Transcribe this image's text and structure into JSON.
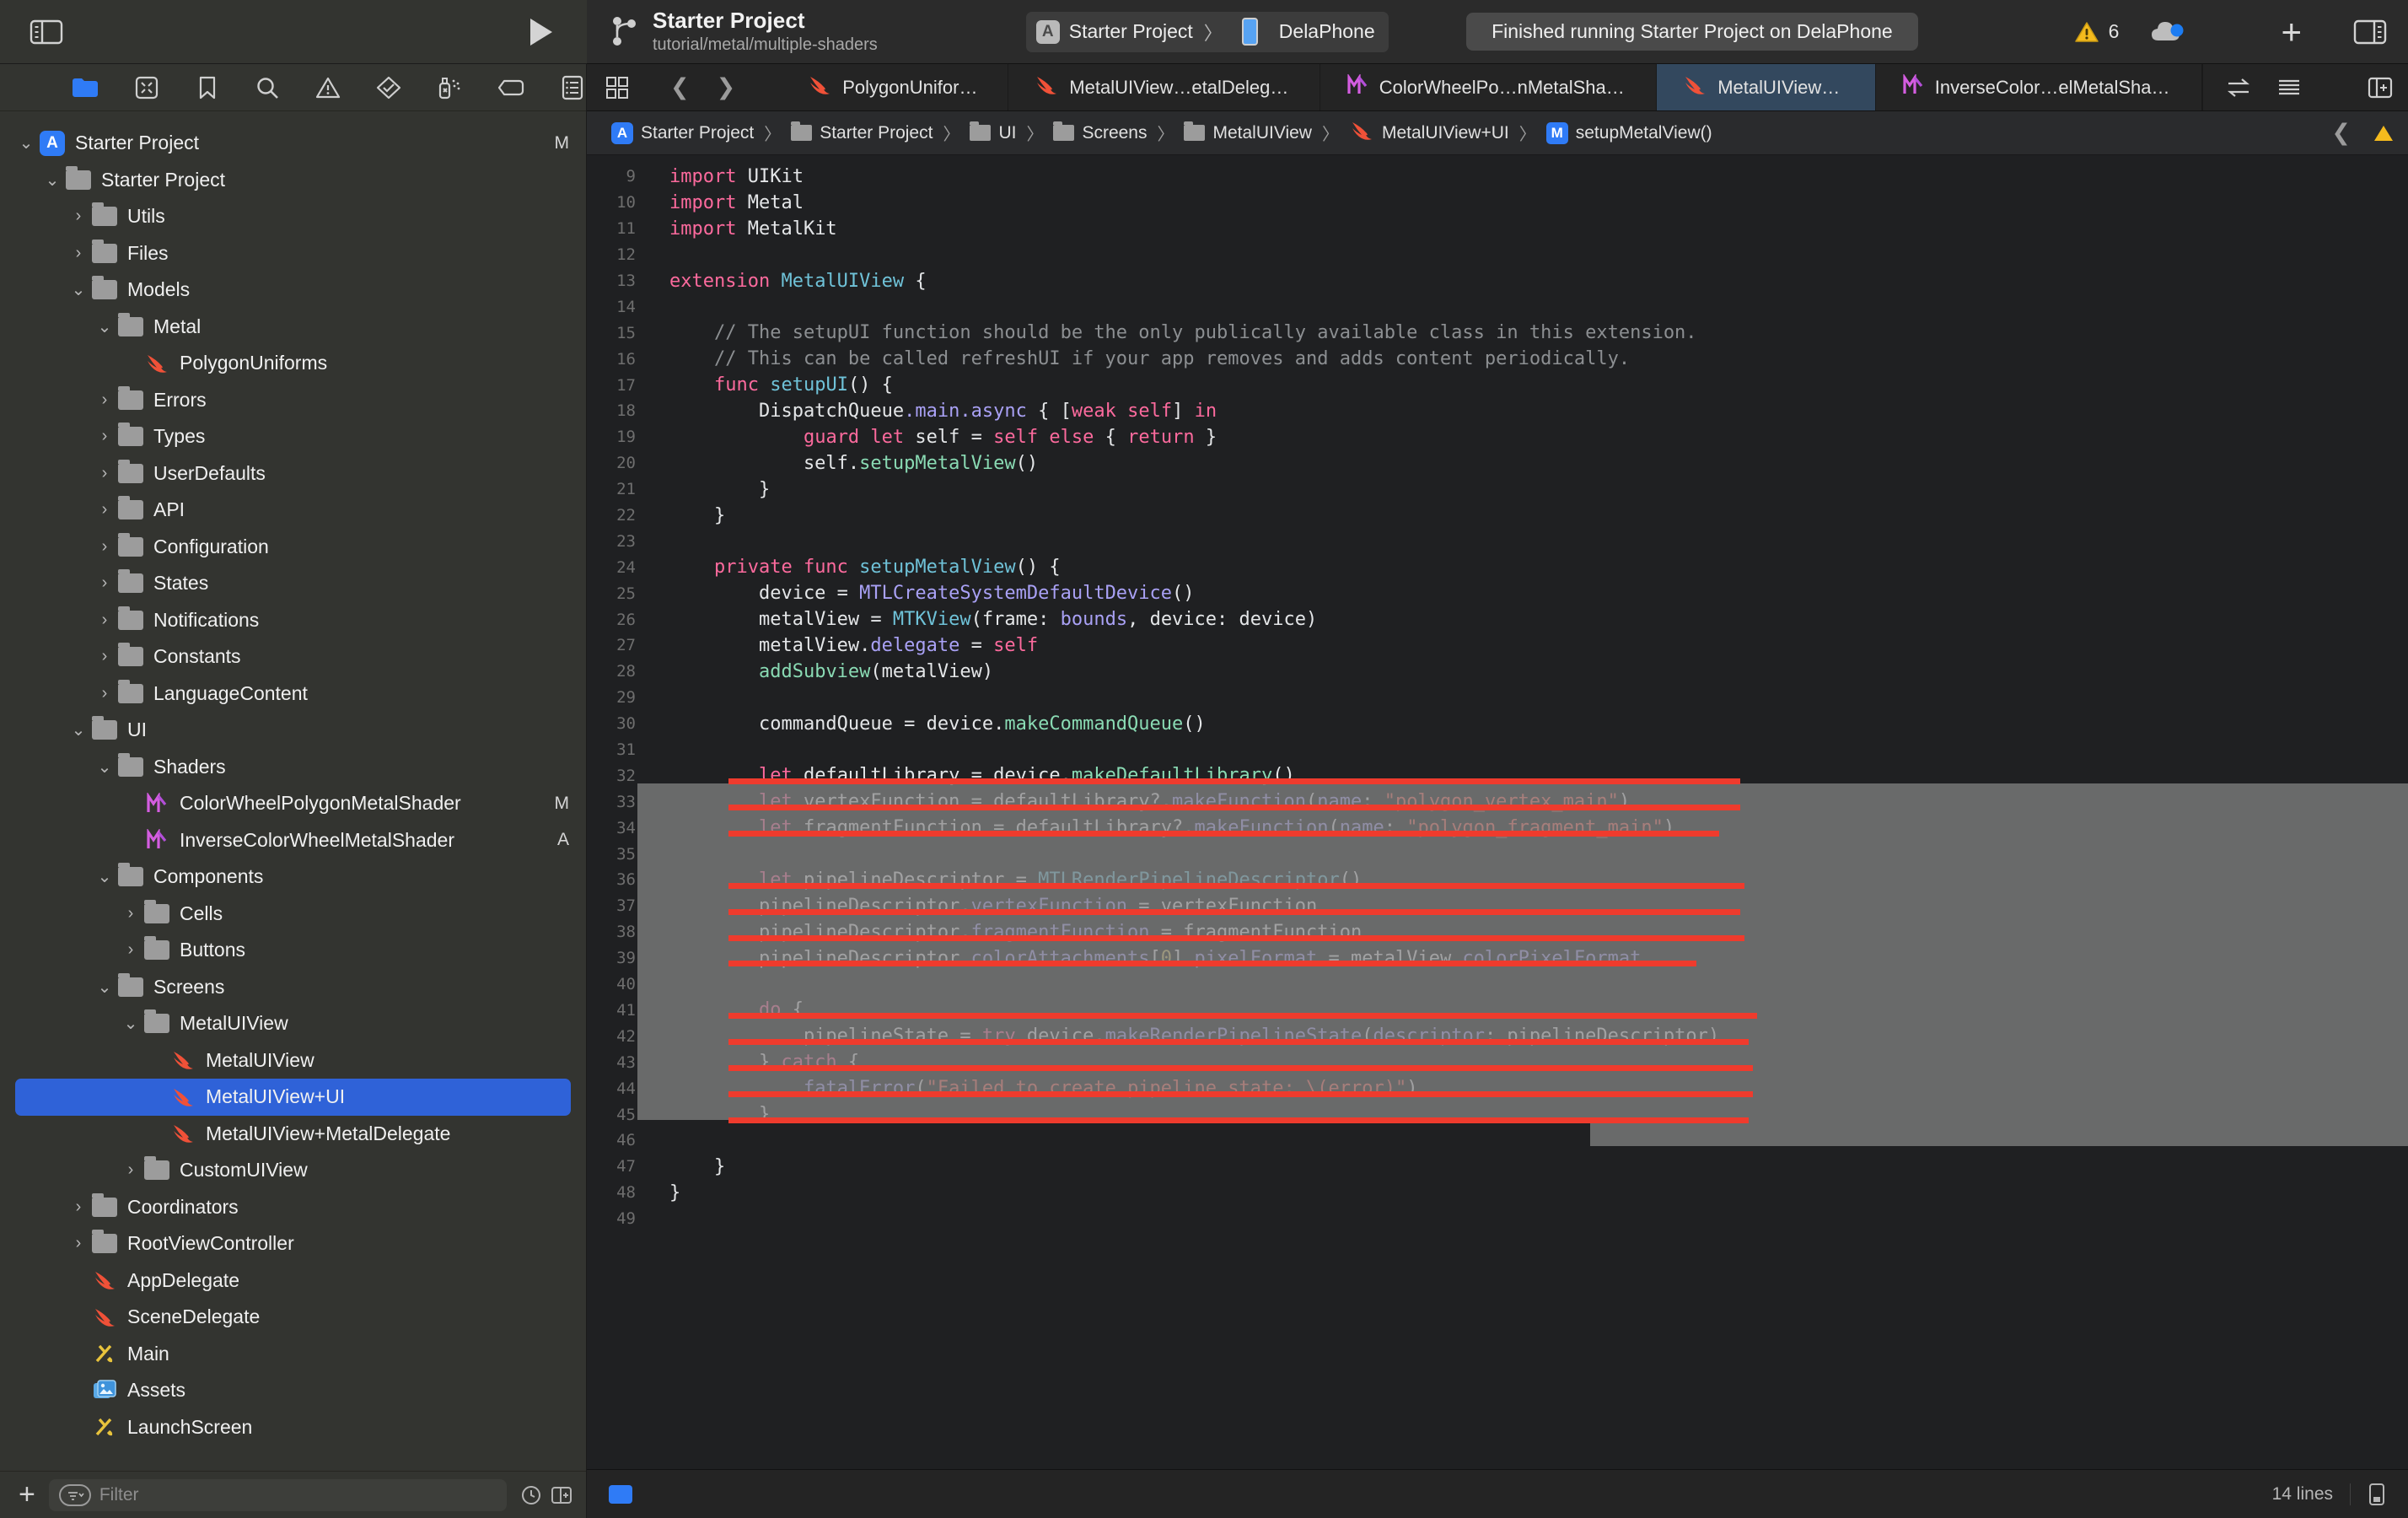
{
  "toolbar": {
    "sidebar_toggle": "sidebar-toggle",
    "run_button": "run",
    "project_name": "Starter Project",
    "branch": "tutorial/metal/multiple-shaders",
    "scheme_name": "Starter Project",
    "scheme_chevron": "〉",
    "device_name": "DelaPhone",
    "status_message": "Finished running Starter Project on DelaPhone",
    "warning_count": "6",
    "add_label": "+"
  },
  "navigator": {
    "toolbar_icons": [
      {
        "name": "folder-icon",
        "active": true
      },
      {
        "name": "source-control-icon",
        "active": false
      },
      {
        "name": "bookmark-icon",
        "active": false
      },
      {
        "name": "search-icon",
        "active": false
      },
      {
        "name": "issue-warning-icon",
        "active": false
      },
      {
        "name": "test-diamond-icon",
        "active": false
      },
      {
        "name": "debug-spray-icon",
        "active": false
      },
      {
        "name": "breakpoint-tag-icon",
        "active": false
      },
      {
        "name": "report-list-icon",
        "active": false
      }
    ],
    "items": [
      {
        "label": "Starter Project",
        "icon": "app-icon",
        "depth": 0,
        "disc": "down",
        "status": "M"
      },
      {
        "label": "Starter Project",
        "icon": "folder",
        "depth": 1,
        "disc": "down",
        "status": ""
      },
      {
        "label": "Utils",
        "icon": "folder",
        "depth": 2,
        "disc": "right",
        "status": ""
      },
      {
        "label": "Files",
        "icon": "folder",
        "depth": 2,
        "disc": "right",
        "status": ""
      },
      {
        "label": "Models",
        "icon": "folder",
        "depth": 2,
        "disc": "down",
        "status": ""
      },
      {
        "label": "Metal",
        "icon": "folder",
        "depth": 3,
        "disc": "down",
        "status": ""
      },
      {
        "label": "PolygonUniforms",
        "icon": "swift",
        "depth": 4,
        "disc": "none",
        "status": ""
      },
      {
        "label": "Errors",
        "icon": "folder",
        "depth": 3,
        "disc": "right",
        "status": ""
      },
      {
        "label": "Types",
        "icon": "folder",
        "depth": 3,
        "disc": "right",
        "status": ""
      },
      {
        "label": "UserDefaults",
        "icon": "folder",
        "depth": 3,
        "disc": "right",
        "status": ""
      },
      {
        "label": "API",
        "icon": "folder",
        "depth": 3,
        "disc": "right",
        "status": ""
      },
      {
        "label": "Configuration",
        "icon": "folder",
        "depth": 3,
        "disc": "right",
        "status": ""
      },
      {
        "label": "States",
        "icon": "folder",
        "depth": 3,
        "disc": "right",
        "status": ""
      },
      {
        "label": "Notifications",
        "icon": "folder",
        "depth": 3,
        "disc": "right",
        "status": ""
      },
      {
        "label": "Constants",
        "icon": "folder",
        "depth": 3,
        "disc": "right",
        "status": ""
      },
      {
        "label": "LanguageContent",
        "icon": "folder",
        "depth": 3,
        "disc": "right",
        "status": ""
      },
      {
        "label": "UI",
        "icon": "folder",
        "depth": 2,
        "disc": "down",
        "status": ""
      },
      {
        "label": "Shaders",
        "icon": "folder",
        "depth": 3,
        "disc": "down",
        "status": ""
      },
      {
        "label": "ColorWheelPolygonMetalShader",
        "icon": "metal",
        "depth": 4,
        "disc": "none",
        "status": "M"
      },
      {
        "label": "InverseColorWheelMetalShader",
        "icon": "metal",
        "depth": 4,
        "disc": "none",
        "status": "A"
      },
      {
        "label": "Components",
        "icon": "folder",
        "depth": 3,
        "disc": "down",
        "status": ""
      },
      {
        "label": "Cells",
        "icon": "folder",
        "depth": 4,
        "disc": "right",
        "status": ""
      },
      {
        "label": "Buttons",
        "icon": "folder",
        "depth": 4,
        "disc": "right",
        "status": ""
      },
      {
        "label": "Screens",
        "icon": "folder",
        "depth": 3,
        "disc": "down",
        "status": ""
      },
      {
        "label": "MetalUIView",
        "icon": "folder",
        "depth": 4,
        "disc": "down",
        "status": ""
      },
      {
        "label": "MetalUIView",
        "icon": "swift",
        "depth": 5,
        "disc": "none",
        "status": ""
      },
      {
        "label": "MetalUIView+UI",
        "icon": "swift",
        "depth": 5,
        "disc": "none",
        "status": "",
        "selected": true
      },
      {
        "label": "MetalUIView+MetalDelegate",
        "icon": "swift",
        "depth": 5,
        "disc": "none",
        "status": ""
      },
      {
        "label": "CustomUIView",
        "icon": "folder",
        "depth": 4,
        "disc": "right",
        "status": ""
      },
      {
        "label": "Coordinators",
        "icon": "folder",
        "depth": 2,
        "disc": "right",
        "status": ""
      },
      {
        "label": "RootViewController",
        "icon": "folder",
        "depth": 2,
        "disc": "right",
        "status": ""
      },
      {
        "label": "AppDelegate",
        "icon": "swift",
        "depth": 2,
        "disc": "none",
        "status": ""
      },
      {
        "label": "SceneDelegate",
        "icon": "swift",
        "depth": 2,
        "disc": "none",
        "status": ""
      },
      {
        "label": "Main",
        "icon": "xib",
        "depth": 2,
        "disc": "none",
        "status": ""
      },
      {
        "label": "Assets",
        "icon": "assets",
        "depth": 2,
        "disc": "none",
        "status": ""
      },
      {
        "label": "LaunchScreen",
        "icon": "xib",
        "depth": 2,
        "disc": "none",
        "status": ""
      }
    ],
    "filter_placeholder": "Filter",
    "add_button": "+"
  },
  "editor": {
    "tabs": [
      {
        "label": "PolygonUniforms",
        "icon": "swift",
        "active": false
      },
      {
        "label": "MetalUIView…etalDelegate",
        "icon": "swift",
        "active": false
      },
      {
        "label": "ColorWheelPo…nMetalShader",
        "icon": "metal",
        "active": false
      },
      {
        "label": "MetalUIView+UI",
        "icon": "swift",
        "active": true
      },
      {
        "label": "InverseColor…elMetalShader",
        "icon": "metal",
        "active": false
      }
    ],
    "breadcrumb": [
      {
        "label": "Starter Project",
        "icon": "app-icon"
      },
      {
        "label": "Starter Project",
        "icon": "folder"
      },
      {
        "label": "UI",
        "icon": "folder"
      },
      {
        "label": "Screens",
        "icon": "folder"
      },
      {
        "label": "MetalUIView",
        "icon": "folder"
      },
      {
        "label": "MetalUIView+UI",
        "icon": "swift"
      },
      {
        "label": "setupMetalView()",
        "icon": "method-m"
      }
    ],
    "status_lines": "14 lines"
  },
  "code": {
    "first_line_number": 9,
    "lines": [
      {
        "n": 9,
        "tokens": [
          {
            "t": "import ",
            "c": "kw"
          },
          {
            "t": "UIKit",
            "c": "pln"
          }
        ]
      },
      {
        "n": 10,
        "tokens": [
          {
            "t": "import ",
            "c": "kw"
          },
          {
            "t": "Metal",
            "c": "pln"
          }
        ]
      },
      {
        "n": 11,
        "tokens": [
          {
            "t": "import ",
            "c": "kw"
          },
          {
            "t": "MetalKit",
            "c": "pln"
          }
        ]
      },
      {
        "n": 12,
        "tokens": []
      },
      {
        "n": 13,
        "tokens": [
          {
            "t": "extension ",
            "c": "kw"
          },
          {
            "t": "MetalUIView",
            "c": "typ"
          },
          {
            "t": " {",
            "c": "pln"
          }
        ]
      },
      {
        "n": 14,
        "tokens": []
      },
      {
        "n": 15,
        "tokens": [
          {
            "t": "    // The setupUI function should be the only publically available class in this extension.",
            "c": "cmt"
          }
        ]
      },
      {
        "n": 16,
        "tokens": [
          {
            "t": "    // This can be called refreshUI if your app removes and adds content periodically.",
            "c": "cmt"
          }
        ]
      },
      {
        "n": 17,
        "tokens": [
          {
            "t": "    ",
            "c": "pln"
          },
          {
            "t": "func ",
            "c": "kw"
          },
          {
            "t": "setupUI",
            "c": "typ"
          },
          {
            "t": "() {",
            "c": "pln"
          }
        ]
      },
      {
        "n": 18,
        "tokens": [
          {
            "t": "        DispatchQueue",
            "c": "pln"
          },
          {
            "t": ".main",
            "c": "mem"
          },
          {
            "t": ".async",
            "c": "mem"
          },
          {
            "t": " { [",
            "c": "pln"
          },
          {
            "t": "weak self",
            "c": "kw"
          },
          {
            "t": "] ",
            "c": "pln"
          },
          {
            "t": "in",
            "c": "kw"
          }
        ]
      },
      {
        "n": 19,
        "tokens": [
          {
            "t": "            ",
            "c": "pln"
          },
          {
            "t": "guard let ",
            "c": "kw"
          },
          {
            "t": "self = ",
            "c": "pln"
          },
          {
            "t": "self else",
            "c": "kw"
          },
          {
            "t": " { ",
            "c": "pln"
          },
          {
            "t": "return",
            "c": "kw"
          },
          {
            "t": " }",
            "c": "pln"
          }
        ]
      },
      {
        "n": 20,
        "tokens": [
          {
            "t": "            self.",
            "c": "pln"
          },
          {
            "t": "setupMetalView",
            "c": "fn"
          },
          {
            "t": "()",
            "c": "pln"
          }
        ]
      },
      {
        "n": 21,
        "tokens": [
          {
            "t": "        }",
            "c": "pln"
          }
        ]
      },
      {
        "n": 22,
        "tokens": [
          {
            "t": "    }",
            "c": "pln"
          }
        ]
      },
      {
        "n": 23,
        "tokens": []
      },
      {
        "n": 24,
        "tokens": [
          {
            "t": "    ",
            "c": "pln"
          },
          {
            "t": "private func ",
            "c": "kw"
          },
          {
            "t": "setupMetalView",
            "c": "typ"
          },
          {
            "t": "() {",
            "c": "pln"
          }
        ]
      },
      {
        "n": 25,
        "tokens": [
          {
            "t": "        device = ",
            "c": "pln"
          },
          {
            "t": "MTLCreateSystemDefaultDevice",
            "c": "mem"
          },
          {
            "t": "()",
            "c": "pln"
          }
        ]
      },
      {
        "n": 26,
        "tokens": [
          {
            "t": "        metalView = ",
            "c": "pln"
          },
          {
            "t": "MTKView",
            "c": "typ"
          },
          {
            "t": "(frame: ",
            "c": "pln"
          },
          {
            "t": "bounds",
            "c": "mem"
          },
          {
            "t": ", device: device)",
            "c": "pln"
          }
        ]
      },
      {
        "n": 27,
        "tokens": [
          {
            "t": "        metalView.",
            "c": "pln"
          },
          {
            "t": "delegate",
            "c": "mem"
          },
          {
            "t": " = ",
            "c": "pln"
          },
          {
            "t": "self",
            "c": "kw"
          }
        ]
      },
      {
        "n": 28,
        "tokens": [
          {
            "t": "        ",
            "c": "pln"
          },
          {
            "t": "addSubview",
            "c": "fn"
          },
          {
            "t": "(metalView)",
            "c": "pln"
          }
        ]
      },
      {
        "n": 29,
        "tokens": []
      },
      {
        "n": 30,
        "tokens": [
          {
            "t": "        commandQueue = device.",
            "c": "pln"
          },
          {
            "t": "makeCommandQueue",
            "c": "fn"
          },
          {
            "t": "()",
            "c": "pln"
          }
        ]
      },
      {
        "n": 31,
        "tokens": []
      },
      {
        "n": 32,
        "tokens": [
          {
            "t": "        ",
            "c": "pln"
          },
          {
            "t": "let ",
            "c": "kw"
          },
          {
            "t": "defaultLibrary = device.",
            "c": "pln"
          },
          {
            "t": "makeDefaultLibrary",
            "c": "fn"
          },
          {
            "t": "()",
            "c": "pln"
          }
        ]
      },
      {
        "n": 33,
        "tokens": [
          {
            "t": "        ",
            "c": "pln"
          },
          {
            "t": "let ",
            "c": "kw"
          },
          {
            "t": "vertexFunction = defaultLibrary?.",
            "c": "pln"
          },
          {
            "t": "makeFunction",
            "c": "mem"
          },
          {
            "t": "(",
            "c": "pln"
          },
          {
            "t": "name",
            "c": "mem"
          },
          {
            "t": ": ",
            "c": "pln"
          },
          {
            "t": "\"polygon_vertex_main\"",
            "c": "str"
          },
          {
            "t": ")",
            "c": "pln"
          }
        ]
      },
      {
        "n": 34,
        "tokens": [
          {
            "t": "        ",
            "c": "pln"
          },
          {
            "t": "let ",
            "c": "kw"
          },
          {
            "t": "fragmentFunction = defaultLibrary?.",
            "c": "pln"
          },
          {
            "t": "makeFunction",
            "c": "mem"
          },
          {
            "t": "(",
            "c": "pln"
          },
          {
            "t": "name",
            "c": "mem"
          },
          {
            "t": ": ",
            "c": "pln"
          },
          {
            "t": "\"polygon_fragment_main\"",
            "c": "str"
          },
          {
            "t": ")",
            "c": "pln"
          }
        ]
      },
      {
        "n": 35,
        "tokens": []
      },
      {
        "n": 36,
        "tokens": [
          {
            "t": "        ",
            "c": "pln"
          },
          {
            "t": "let ",
            "c": "kw"
          },
          {
            "t": "pipelineDescriptor = ",
            "c": "pln"
          },
          {
            "t": "MTLRenderPipelineDescriptor",
            "c": "typ"
          },
          {
            "t": "()",
            "c": "pln"
          }
        ]
      },
      {
        "n": 37,
        "tokens": [
          {
            "t": "        pipelineDescriptor.",
            "c": "pln"
          },
          {
            "t": "vertexFunction",
            "c": "mem"
          },
          {
            "t": " = vertexFunction",
            "c": "pln"
          }
        ]
      },
      {
        "n": 38,
        "tokens": [
          {
            "t": "        pipelineDescriptor.",
            "c": "pln"
          },
          {
            "t": "fragmentFunction",
            "c": "mem"
          },
          {
            "t": " = fragmentFunction",
            "c": "pln"
          }
        ]
      },
      {
        "n": 39,
        "tokens": [
          {
            "t": "        pipelineDescriptor.",
            "c": "pln"
          },
          {
            "t": "colorAttachments",
            "c": "mem"
          },
          {
            "t": "[",
            "c": "pln"
          },
          {
            "t": "0",
            "c": "num"
          },
          {
            "t": "].",
            "c": "pln"
          },
          {
            "t": "pixelFormat",
            "c": "mem"
          },
          {
            "t": " = metalView.",
            "c": "pln"
          },
          {
            "t": "colorPixelFormat",
            "c": "mem"
          }
        ]
      },
      {
        "n": 40,
        "tokens": []
      },
      {
        "n": 41,
        "tokens": [
          {
            "t": "        ",
            "c": "pln"
          },
          {
            "t": "do",
            "c": "kw"
          },
          {
            "t": " {",
            "c": "pln"
          }
        ]
      },
      {
        "n": 42,
        "tokens": [
          {
            "t": "            pipelineState = ",
            "c": "pln"
          },
          {
            "t": "try",
            "c": "kw"
          },
          {
            "t": " device.",
            "c": "pln"
          },
          {
            "t": "makeRenderPipelineState",
            "c": "mem"
          },
          {
            "t": "(",
            "c": "pln"
          },
          {
            "t": "descriptor",
            "c": "mem"
          },
          {
            "t": ": pipelineDescriptor)",
            "c": "pln"
          }
        ]
      },
      {
        "n": 43,
        "tokens": [
          {
            "t": "        } ",
            "c": "pln"
          },
          {
            "t": "catch",
            "c": "kw"
          },
          {
            "t": " {",
            "c": "pln"
          }
        ]
      },
      {
        "n": 44,
        "tokens": [
          {
            "t": "            ",
            "c": "pln"
          },
          {
            "t": "fatalError",
            "c": "mem"
          },
          {
            "t": "(",
            "c": "pln"
          },
          {
            "t": "\"Failed to create pipeline state: \\(error)\"",
            "c": "str"
          },
          {
            "t": ")",
            "c": "pln"
          }
        ]
      },
      {
        "n": 45,
        "tokens": [
          {
            "t": "        }",
            "c": "pln"
          }
        ]
      },
      {
        "n": 46,
        "tokens": []
      },
      {
        "n": 47,
        "tokens": [
          {
            "t": "    }",
            "c": "pln"
          }
        ]
      },
      {
        "n": 48,
        "tokens": [
          {
            "t": "}",
            "c": "pln"
          }
        ]
      },
      {
        "n": 49,
        "tokens": []
      }
    ],
    "strike_lines": [
      32,
      33,
      34,
      36,
      37,
      38,
      39,
      41,
      42,
      43,
      44,
      45
    ],
    "selection": {
      "from_line": 32,
      "to_line": 45
    }
  },
  "colors": {
    "accent": "#2f62d8",
    "strike": "#ef3b2d",
    "swift_orange": "#f05138",
    "metal_pink": "#d45de0",
    "warning_yellow": "#f5bb1d"
  }
}
